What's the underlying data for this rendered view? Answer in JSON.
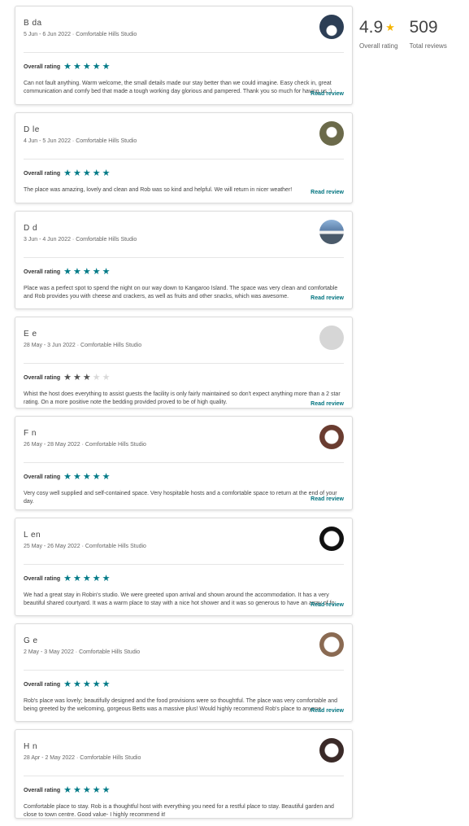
{
  "summary": {
    "overall_value": "4.9",
    "overall_label": "Overall rating",
    "total_value": "509",
    "total_label": "Total reviews"
  },
  "labels": {
    "overall_rating": "Overall rating",
    "read_review": "Read review"
  },
  "colors": {
    "accent": "#007a87",
    "star_gold": "#f5b400"
  },
  "reviews": [
    {
      "name": "B  da",
      "dates": "5 Jun - 6 Jun 2022 · Comfortable Hills Studio",
      "rating": 5,
      "text": "Can not fault anything. Warm welcome, the small details made our stay better than we could imagine. Easy check in, great communication and comfy bed that made a tough working day glorious and pampered. Thank you so much for having us :)"
    },
    {
      "name": "D   le",
      "dates": "4 Jun - 5 Jun 2022 · Comfortable Hills Studio",
      "rating": 5,
      "text": "The place was amazing, lovely and clean and Rob was so kind and helpful. We will return in nicer weather!"
    },
    {
      "name": "D   d",
      "dates": "3 Jun - 4 Jun 2022 · Comfortable Hills Studio",
      "rating": 5,
      "text": "Place was a perfect spot to spend the night on our way down to Kangaroo Island. The space was very clean and comfortable and Rob provides you with cheese and crackers, as well as fruits and other snacks, which was awesome."
    },
    {
      "name": "E   e",
      "dates": "28 May - 3 Jun 2022 · Comfortable Hills Studio",
      "rating": 3,
      "text": "Whist the host does everything to assist guests the facility is only fairly maintained so don't expect anything more than a 2 star rating. On a more positive note the bedding provided proved to be of high quality."
    },
    {
      "name": "F   n",
      "dates": "26 May - 28 May 2022 · Comfortable Hills Studio",
      "rating": 5,
      "text": "Very cosy well supplied and self-contained space. Very hospitable hosts and a comfortable space to return at the end of your day."
    },
    {
      "name": "L   en",
      "dates": "25 May - 26 May 2022 · Comfortable Hills Studio",
      "rating": 5,
      "text": "We had a great stay in Robin's studio. We were greeted upon arrival and shown around the accommodation. It has a very beautiful shared courtyard. It was a warm place to stay with a nice hot shower and it was so generous to have an array of fo..."
    },
    {
      "name": "G   e",
      "dates": "2 May - 3 May 2022 · Comfortable Hills Studio",
      "rating": 5,
      "text": "Rob's place was lovely; beautifully designed and the food provisions were so thoughtful. The place was very comfortable and being greeted by the welcoming, gorgeous Betts was a massive plus! Would highly recommend Rob's place to anyone."
    },
    {
      "name": "H   n",
      "dates": "28 Apr - 2 May 2022 · Comfortable Hills Studio",
      "rating": 5,
      "text": "Comfortable place to stay. Rob is a thoughtful host with everything you need for a restful place to stay. Beautiful garden and close to town centre. Good value- I highly recommend it!"
    }
  ]
}
